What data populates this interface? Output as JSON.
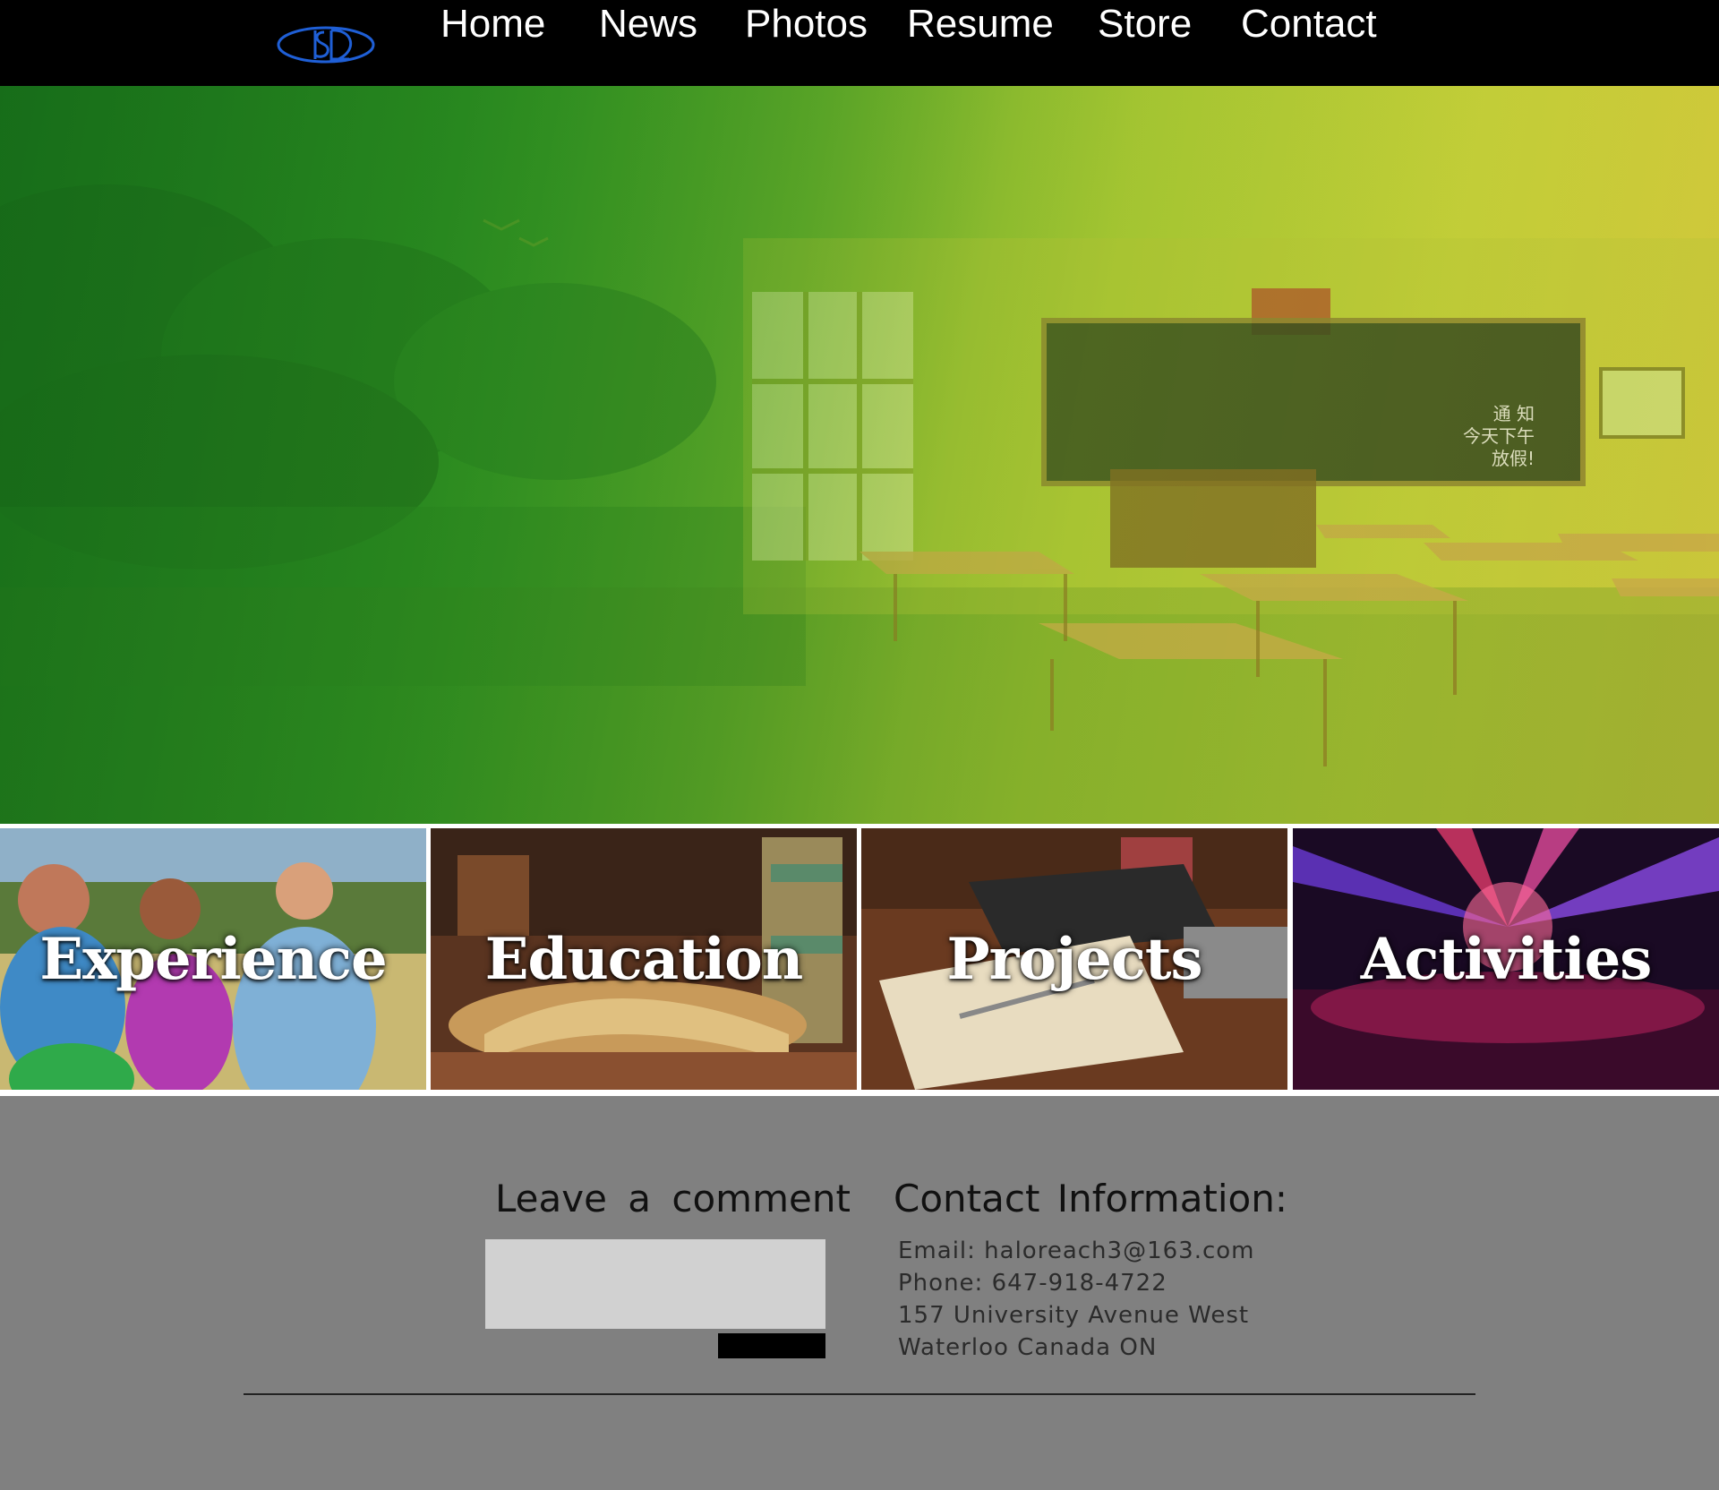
{
  "nav": {
    "logo_icon": "sl-monogram-logo",
    "items": [
      {
        "label": "Home"
      },
      {
        "label": "News"
      },
      {
        "label": "Photos"
      },
      {
        "label": "Resume"
      },
      {
        "label": "Store"
      },
      {
        "label": "Contact"
      }
    ]
  },
  "hero": {
    "image": "classroom-and-trees-green-yellow-gradient",
    "chalkboard_text": [
      "通 知",
      "今天下午",
      "放假!"
    ]
  },
  "tiles": [
    {
      "label": "Experience",
      "image": "family-outdoors-photo"
    },
    {
      "label": "Education",
      "image": "books-photo"
    },
    {
      "label": "Projects",
      "image": "desk-notebook-photo"
    },
    {
      "label": "Activities",
      "image": "concert-lights-photo"
    }
  ],
  "footer": {
    "comment_title": "Leave a comment",
    "comment_placeholder": "",
    "submit_label": "",
    "contact_title": "Contact Information:",
    "email": "Email: haloreach3@163.com",
    "phone": "Phone: 647-918-4722",
    "address_line1": "157 University Avenue West",
    "address_line2": "Waterloo Canada ON"
  },
  "colors": {
    "nav_bg": "#000000",
    "nav_text": "#ffffff",
    "logo_blue": "#1f5fd6",
    "footer_bg": "#808080",
    "comment_box": "#d1d1d1",
    "hero_green": "#2d8a22",
    "hero_yellow": "#c8cf3a"
  }
}
